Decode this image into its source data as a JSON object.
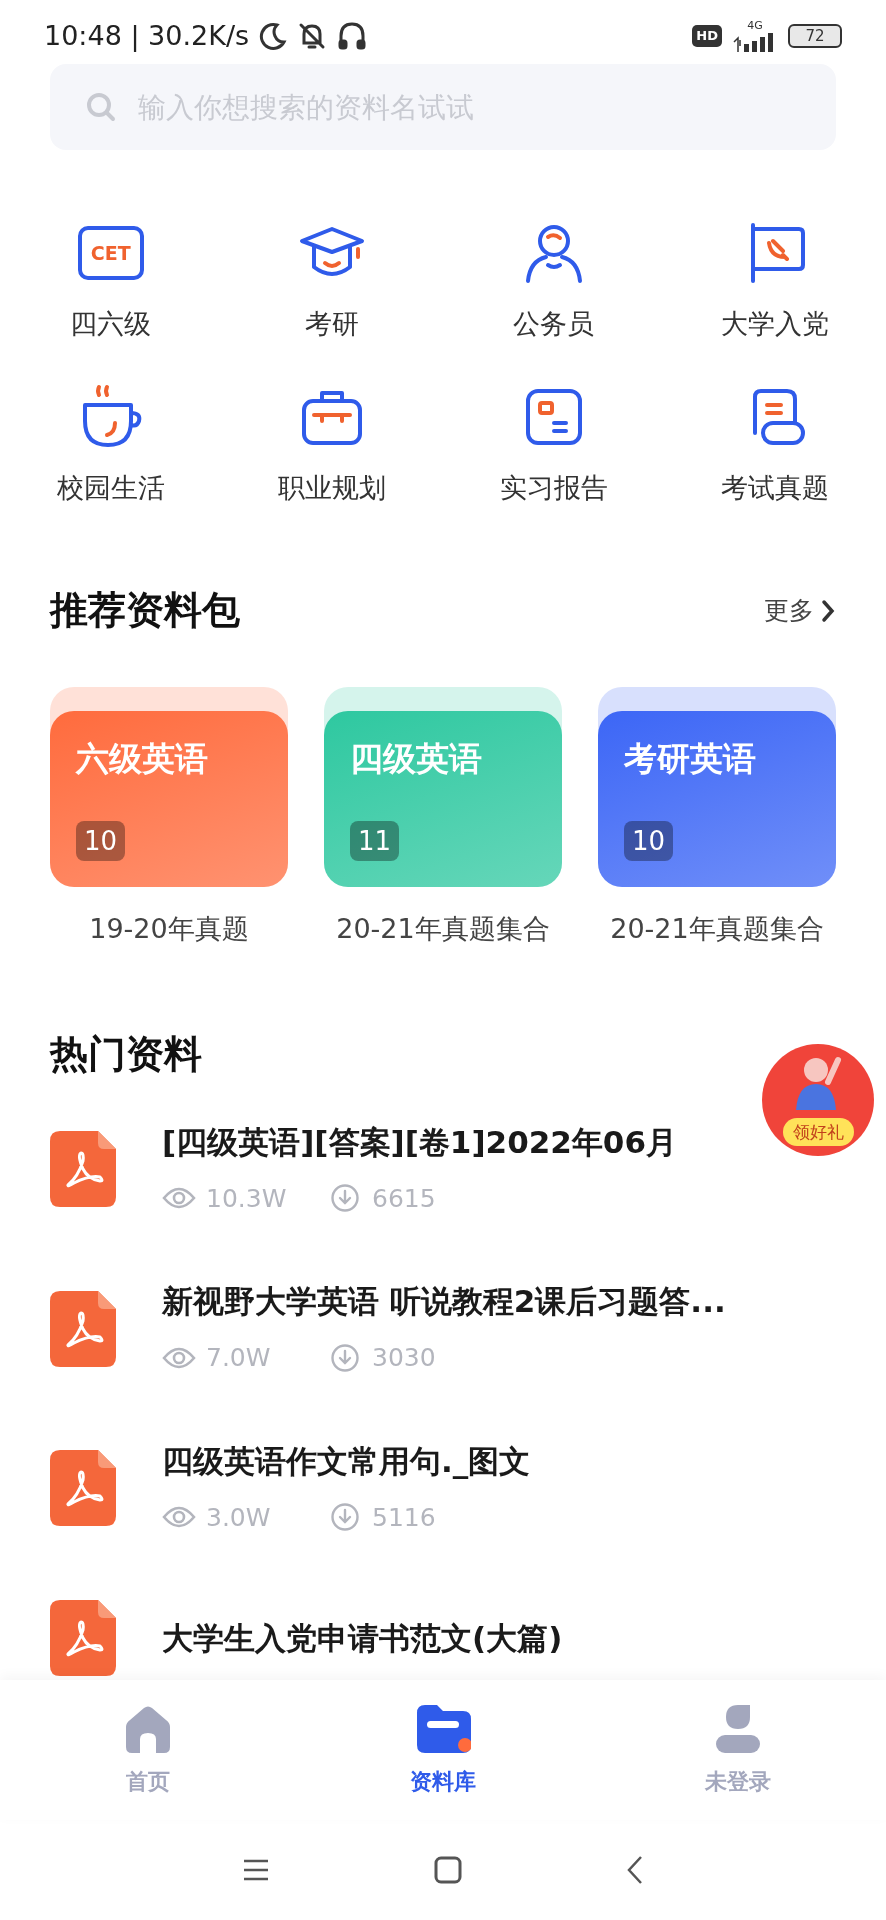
{
  "status_bar": {
    "time": "10:48 | 30.2K/s",
    "hd": "HD",
    "network": "4G",
    "battery": "72"
  },
  "search": {
    "placeholder": "输入你想搜索的资料名试试"
  },
  "categories": [
    {
      "label": "四六级",
      "kind": "cet",
      "icon_text": "CET"
    },
    {
      "label": "考研",
      "kind": "cap"
    },
    {
      "label": "公务员",
      "kind": "person"
    },
    {
      "label": "大学入党",
      "kind": "flag"
    },
    {
      "label": "校园生活",
      "kind": "cup"
    },
    {
      "label": "职业规划",
      "kind": "briefcase"
    },
    {
      "label": "实习报告",
      "kind": "card"
    },
    {
      "label": "考试真题",
      "kind": "scroll"
    }
  ],
  "packages": {
    "title": "推荐资料包",
    "more": "更多",
    "items": [
      {
        "name": "六级英语",
        "count": "10",
        "caption": "19-20年真题",
        "color": "#ff6b3d"
      },
      {
        "name": "四级英语",
        "count": "11",
        "caption": "20-21年真题集合",
        "color": "#2ec8a0"
      },
      {
        "name": "考研英语",
        "count": "10",
        "caption": "20-21年真题集合",
        "color": "#3c66f6"
      }
    ]
  },
  "hot": {
    "title": "热门资料",
    "items": [
      {
        "title": "[四级英语][答案][卷1]2022年06月",
        "views": "10.3W",
        "downloads": "6615"
      },
      {
        "title": "新视野大学英语 听说教程2课后习题答...",
        "views": "7.0W",
        "downloads": "3030"
      },
      {
        "title": "四级英语作文常用句._图文",
        "views": "3.0W",
        "downloads": "5116"
      },
      {
        "title": "大学生入党申请书范文(大篇)"
      }
    ]
  },
  "promo": {
    "label": "领好礼"
  },
  "tabs": [
    {
      "label": "首页",
      "kind": "home",
      "selected": false
    },
    {
      "label": "资料库",
      "kind": "library",
      "selected": true
    },
    {
      "label": "未登录",
      "kind": "user",
      "selected": false
    }
  ]
}
